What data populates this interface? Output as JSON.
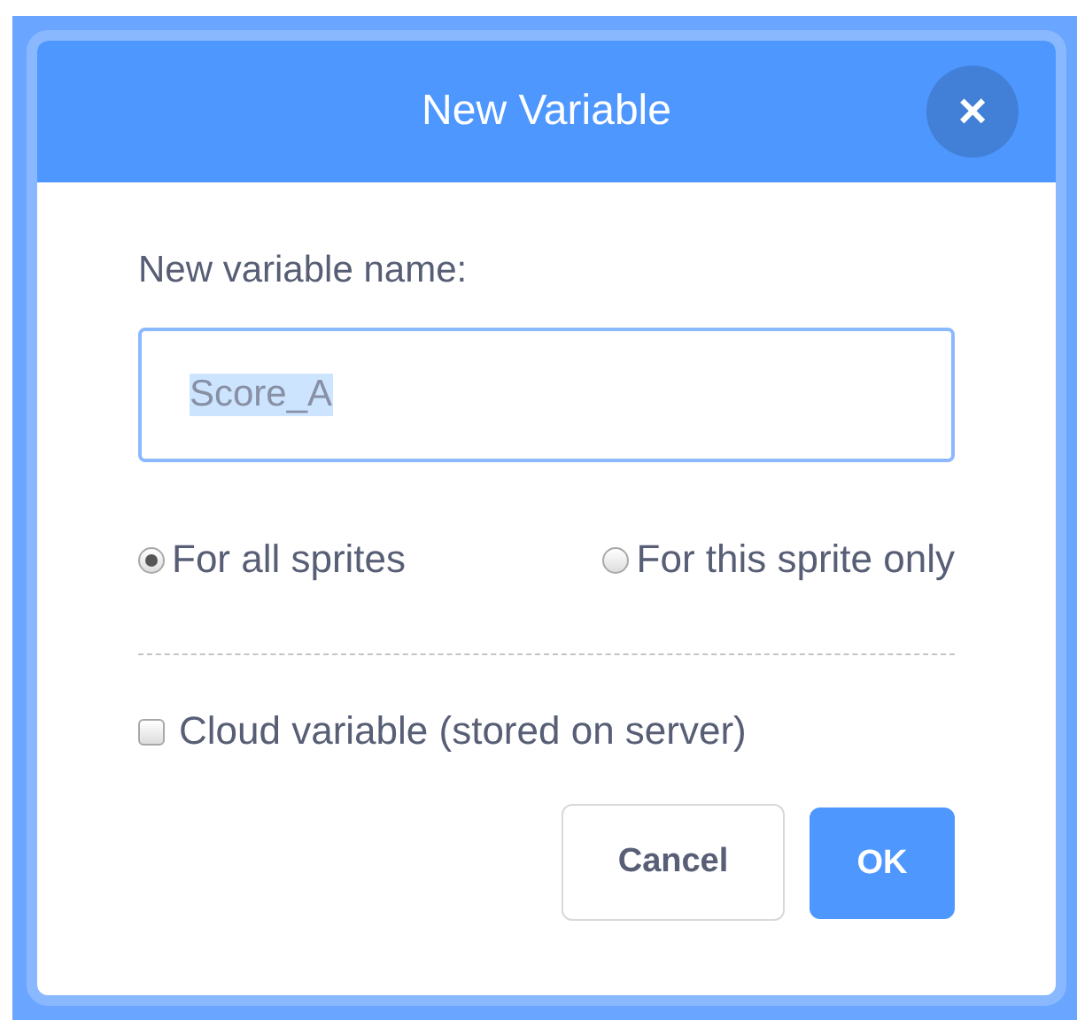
{
  "dialog": {
    "title": "New Variable",
    "close_label": "×"
  },
  "name_field": {
    "label": "New variable name:",
    "value": "Score_A",
    "text_selected": true
  },
  "scope_options": [
    {
      "label": "For all sprites",
      "selected": true
    },
    {
      "label": "For this sprite only",
      "selected": false
    }
  ],
  "cloud_option": {
    "label": "Cloud variable (stored on server)",
    "checked": false
  },
  "buttons": [
    {
      "label": "Cancel",
      "kind": "secondary"
    },
    {
      "label": "OK",
      "kind": "primary"
    }
  ]
}
